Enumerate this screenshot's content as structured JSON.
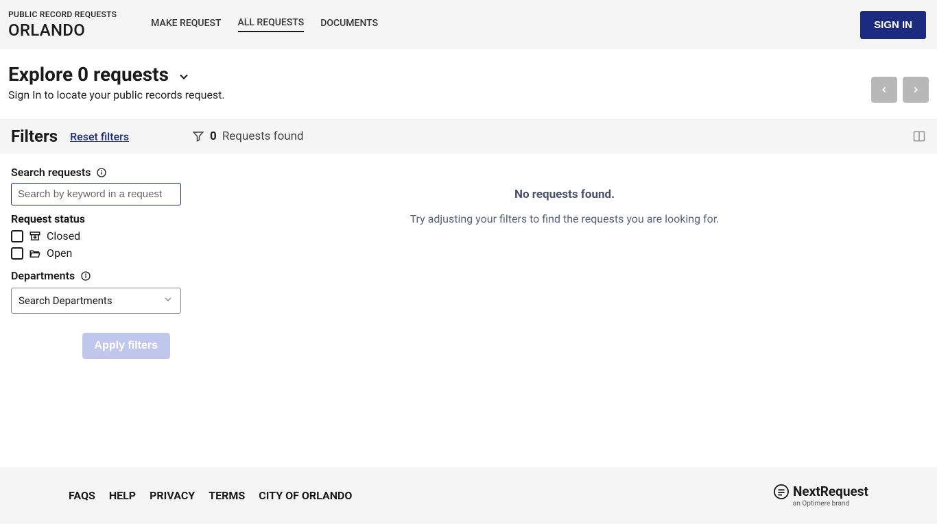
{
  "header": {
    "brand_top": "PUBLIC RECORD REQUESTS",
    "brand_bottom": "ORLANDO",
    "nav": {
      "make_request": "MAKE REQUEST",
      "all_requests": "ALL REQUESTS",
      "documents": "DOCUMENTS"
    },
    "signin": "SIGN IN"
  },
  "page": {
    "title": "Explore 0 requests",
    "subtitle": "Sign In to locate your public records request."
  },
  "filters_bar": {
    "title": "Filters",
    "reset": "Reset filters",
    "count": "0",
    "count_label": "Requests found"
  },
  "filters": {
    "search_label": "Search requests",
    "search_placeholder": "Search by keyword in a request",
    "status_label": "Request status",
    "status_closed": "Closed",
    "status_open": "Open",
    "dept_label": "Departments",
    "dept_placeholder": "Search Departments",
    "apply": "Apply filters"
  },
  "results": {
    "empty_title": "No requests found.",
    "empty_sub": "Try adjusting your filters to find the requests you are looking for."
  },
  "footer": {
    "links": {
      "faqs": "FAQS",
      "help": "HELP",
      "privacy": "PRIVACY",
      "terms": "TERMS",
      "city": "CITY OF ORLANDO"
    },
    "brand": "NextRequest",
    "brand_sub": "an Optimere brand"
  }
}
